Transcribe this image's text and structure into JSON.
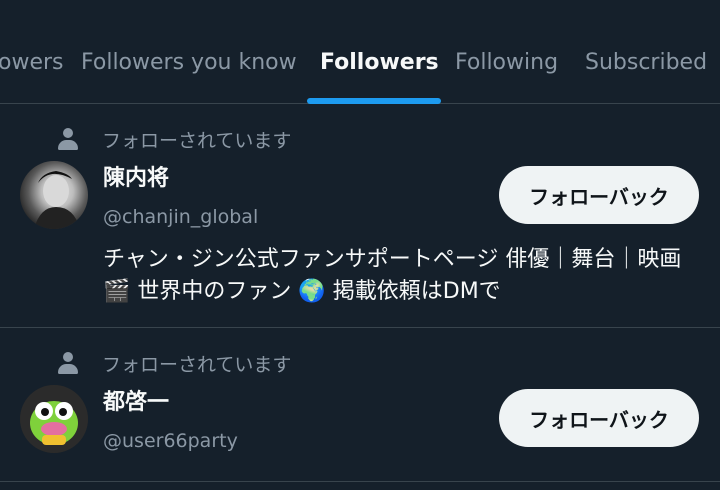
{
  "tabs": [
    {
      "label": "owers",
      "active": false
    },
    {
      "label": "Followers you know",
      "active": false
    },
    {
      "label": "Followers",
      "active": true
    },
    {
      "label": "Following",
      "active": false
    },
    {
      "label": "Subscribed",
      "active": false
    }
  ],
  "users": [
    {
      "social_context": "フォローされています",
      "display_name": "陳内将",
      "handle": "@chanjin_global",
      "button_label": "フォローバック",
      "bio": "チャン・ジン公式ファンサポートページ 俳優｜舞台｜映画 🎬 世界中のファン 🌍 掲載依頼はDMで"
    },
    {
      "social_context": "フォローされています",
      "display_name": "都啓一",
      "handle": "@user66party",
      "button_label": "フォローバック"
    }
  ],
  "colors": {
    "background": "#15202b",
    "accent": "#1d9bf0",
    "secondary_text": "#8b98a5",
    "button_bg": "#eff3f4"
  }
}
